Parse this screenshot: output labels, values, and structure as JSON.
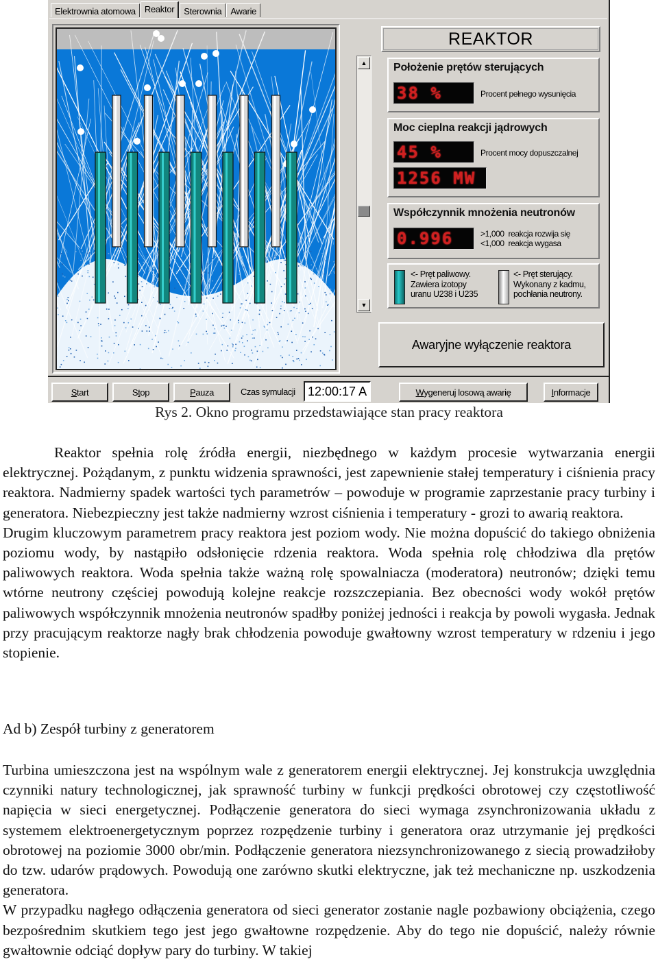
{
  "app": {
    "tabs": [
      {
        "label": "Elektrownia atomowa",
        "active": false
      },
      {
        "label": "Reaktor",
        "active": true
      },
      {
        "label": "Sterownia",
        "active": false
      },
      {
        "label": "Awarie",
        "active": false
      }
    ],
    "reactor_view": {
      "fuel_rod_count": 7,
      "control_rod_count": 6,
      "control_rod_position_percent": 38,
      "colors": {
        "water": "#0a78d8",
        "steam": "#bdbdbd",
        "fuel_rod": "#12867e",
        "control_rod": "#d8d8d8",
        "neutron_trace": "#ffffff"
      }
    },
    "scrollbar": {
      "up_icon": "arrow-up-icon",
      "down_icon": "arrow-down-icon",
      "position_fraction": 0.62
    },
    "panel_title": "REAKTOR",
    "rod_position": {
      "heading": "Położenie prętów sterujących",
      "display": "38 %",
      "note": "Procent pełnego wysunięcia"
    },
    "thermal_power": {
      "heading": "Moc cieplna reakcji jądrowych",
      "display_percent": "45 %",
      "note": "Procent mocy dopuszczalnej",
      "display_mw": "1256 MW"
    },
    "multiplication": {
      "heading": "Współczynnik mnożenia neutronów",
      "display": "0.996",
      "note_line1": ">1,000  reakcja rozwija się",
      "note_line2": "<1,000  reakcja wygasa"
    },
    "legend": {
      "fuel_line1": "<- Pręt paliwowy.",
      "fuel_line2": "Zawiera izotopy",
      "fuel_line3": "uranu U238 i U235",
      "control_line1": "<- Pręt sterujący.",
      "control_line2": "Wykonany z kadmu,",
      "control_line3": "pochłania neutrony."
    },
    "scram_button": "Awaryjne wyłączenie reaktora",
    "toolbar": {
      "start_mnemonic": "S",
      "start_rest": "tart",
      "stop_pre": "S",
      "stop_mnemonic": "t",
      "stop_rest": "op",
      "pause_mnemonic": "P",
      "pause_rest": "auza",
      "time_label": "Czas symulacji",
      "time_value": "12:00:17 A",
      "random_mnemonic": "W",
      "random_rest": "ygeneruj losową awarię",
      "info_mnemonic": "I",
      "info_rest": "nformacje"
    }
  },
  "document": {
    "caption": "Rys 2. Okno programu przedstawiające stan pracy reaktora",
    "paragraph1": "Reaktor spełnia rolę źródła energii, niezbędnego w każdym procesie wytwarzania energii elektrycznej. Pożądanym, z punktu widzenia sprawności, jest zapewnienie stałej temperatury i ciśnienia pracy reaktora. Nadmierny spadek wartości tych parametrów – powoduje w programie zaprzestanie pracy turbiny i generatora. Niebezpieczny jest także nadmierny wzrost ciśnienia i temperatury - grozi to awarią reaktora.",
    "paragraph2": "Drugim kluczowym parametrem pracy reaktora jest poziom wody. Nie można dopuścić do takiego obniżenia poziomu wody, by nastąpiło odsłonięcie rdzenia reaktora. Woda spełnia rolę chłodziwa dla prętów paliwowych reaktora. Woda spełnia także ważną rolę spowalniacza (moderatora) neutronów; dzięki temu wtórne neutrony częściej powodują kolejne reakcje rozszczepiania. Bez obecności wody wokół prętów paliwowych współczynnik mnożenia neutronów spadłby poniżej jedności i reakcja by powoli wygasła. Jednak przy pracującym reaktorze nagły brak chłodzenia powoduje gwałtowny wzrost temperatury w rdzeniu i jego stopienie.",
    "heading_b": "Ad b) Zespół turbiny z generatorem",
    "paragraph3": "Turbina umieszczona jest na wspólnym wale z generatorem energii elektrycznej. Jej konstrukcja uwzględnia czynniki natury technologicznej, jak sprawność turbiny w funkcji prędkości obrotowej czy częstotliwość napięcia w sieci energetycznej. Podłączenie generatora do sieci wymaga zsynchronizowania układu z systemem elektroenergetycznym poprzez rozpędzenie turbiny i generatora oraz utrzymanie jej prędkości obrotowej na poziomie 3000 obr/min. Podłączenie generatora niezsynchronizowanego z siecią prowadziłoby do tzw. udarów prądowych. Powodują one zarówno skutki elektryczne, jak też mechaniczne np. uszkodzenia generatora.",
    "paragraph4": "W przypadku nagłego odłączenia generatora od sieci generator zostanie nagle pozbawiony obciążenia, czego bezpośrednim skutkiem tego jest jego  gwałtowne rozpędzenie. Aby do tego nie dopuścić, należy równie gwałtownie odciąć dopływ pary do turbiny. W takiej"
  }
}
